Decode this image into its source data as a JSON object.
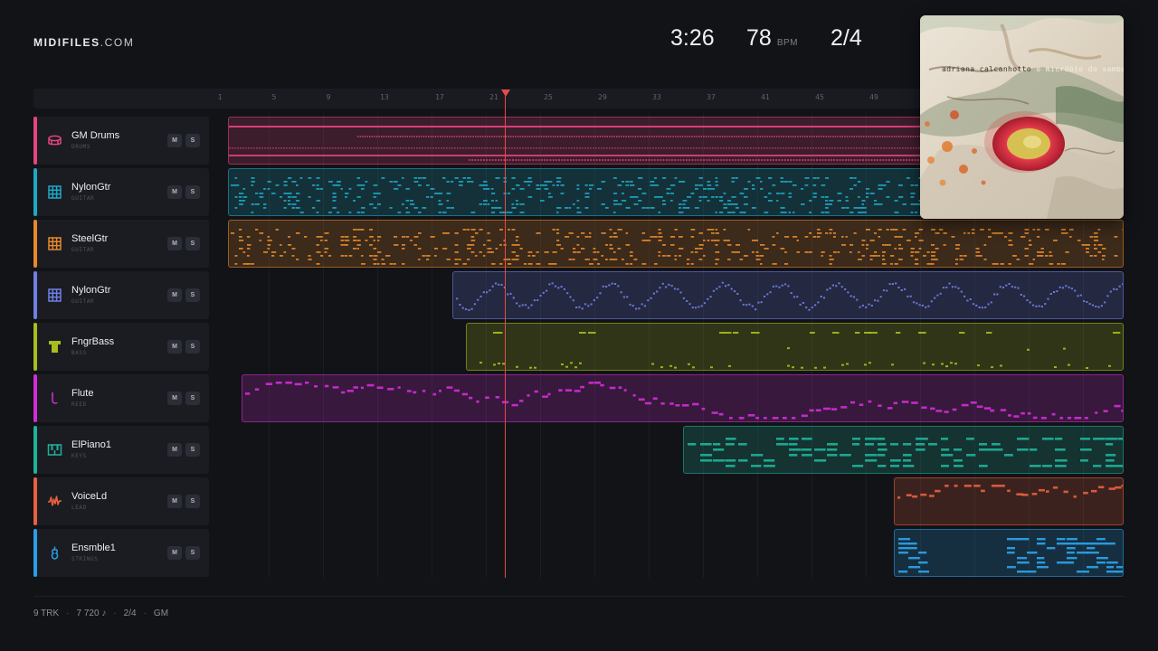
{
  "header": {
    "logo_bold": "MIDIFILES",
    "logo_light": ".COM",
    "duration": "3:26",
    "tempo": "78",
    "tempo_unit": "BPM",
    "time_signature": "2/4"
  },
  "album": {
    "artist": "adriana calcanhotto",
    "title": "o micróbio do samba"
  },
  "ruler": {
    "ticks": [
      "1",
      "5",
      "9",
      "13",
      "17",
      "21",
      "25",
      "29",
      "33",
      "37",
      "41",
      "45",
      "49"
    ]
  },
  "tracks": [
    {
      "name": "GM Drums",
      "category": "DRUMS",
      "color": "#e5447f",
      "icon": "drum-icon",
      "mute": "M",
      "solo": "S"
    },
    {
      "name": "NylonGtr",
      "category": "GUITAR",
      "color": "#1da9c4",
      "icon": "guitar-fretboard-icon",
      "mute": "M",
      "solo": "S"
    },
    {
      "name": "SteelGtr",
      "category": "GUITAR",
      "color": "#e8892a",
      "icon": "guitar-fretboard-icon",
      "mute": "M",
      "solo": "S"
    },
    {
      "name": "NylonGtr",
      "category": "GUITAR",
      "color": "#6f7fe6",
      "icon": "guitar-fretboard-icon",
      "mute": "M",
      "solo": "S"
    },
    {
      "name": "FngrBass",
      "category": "BASS",
      "color": "#a9bd1e",
      "icon": "bass-icon",
      "mute": "M",
      "solo": "S"
    },
    {
      "name": "Flute",
      "category": "REED",
      "color": "#d12ed6",
      "icon": "flute-icon",
      "mute": "M",
      "solo": "S"
    },
    {
      "name": "ElPiano1",
      "category": "KEYS",
      "color": "#1fb39a",
      "icon": "piano-keys-icon",
      "mute": "M",
      "solo": "S"
    },
    {
      "name": "VoiceLd",
      "category": "LEAD",
      "color": "#e8603e",
      "icon": "waveform-icon",
      "mute": "M",
      "solo": "S"
    },
    {
      "name": "Ensmble1",
      "category": "STRINGS",
      "color": "#2a9fe6",
      "icon": "strings-icon",
      "mute": "M",
      "solo": "S"
    }
  ],
  "footer": {
    "tracks": "9 TRK",
    "notes": "7 720 ♪",
    "time_signature": "2/4",
    "standard": "GM"
  }
}
